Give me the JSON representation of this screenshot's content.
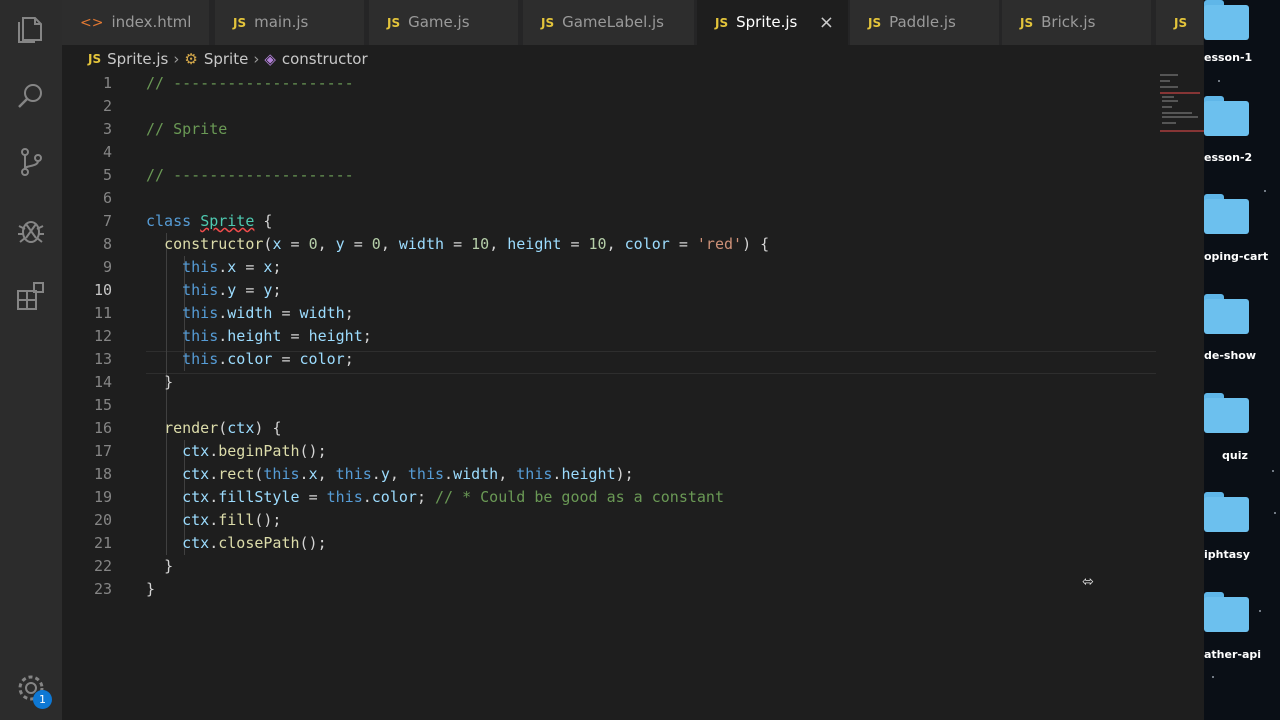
{
  "tabs": [
    {
      "label": "index.html",
      "icon": "html-icon",
      "active": false
    },
    {
      "label": "main.js",
      "icon": "js-icon",
      "active": false
    },
    {
      "label": "Game.js",
      "icon": "js-icon",
      "active": false
    },
    {
      "label": "GameLabel.js",
      "icon": "js-icon",
      "active": false
    },
    {
      "label": "Sprite.js",
      "icon": "js-icon",
      "active": true
    },
    {
      "label": "Paddle.js",
      "icon": "js-icon",
      "active": false
    },
    {
      "label": "Brick.js",
      "icon": "js-icon",
      "active": false
    }
  ],
  "tab_icon_js": "JS",
  "tab_icon_html": "<>",
  "tab_close": "×",
  "breadcrumb": {
    "file": "Sprite.js",
    "class": "Sprite",
    "member": "constructor"
  },
  "code_lines": [
    "// --------------------",
    "",
    "// Sprite",
    "",
    "// --------------------",
    "",
    "class Sprite {",
    "  constructor(x = 0, y = 0, width = 10, height = 10, color = 'red') {",
    "    this.x = x;",
    "    this.y = y;",
    "    this.width = width;",
    "    this.height = height;",
    "    this.color = color;",
    "  }",
    "",
    "  render(ctx) {",
    "    ctx.beginPath();",
    "    ctx.rect(this.x, this.y, this.width, this.height);",
    "    ctx.fillStyle = this.color; // * Could be good as a constant",
    "    ctx.fill();",
    "    ctx.closePath();",
    "  }",
    "}"
  ],
  "current_line": 10,
  "activity_bar": {
    "icons": [
      "explorer-icon",
      "search-icon",
      "source-control-icon",
      "debug-icon",
      "extensions-icon",
      "settings-gear-icon"
    ],
    "badge_count": "1"
  },
  "desktop_folders": [
    "esson-1",
    "esson-2",
    "oping-cart",
    "de-show",
    "quiz",
    "iphtasy",
    "ather-api"
  ],
  "colors": {
    "editor_bg": "#1e1e1e",
    "comment": "#6a9955",
    "keyword": "#569cd6",
    "class": "#4ec9b0",
    "function": "#dcdcaa",
    "variable": "#9cdcfe",
    "number": "#b5cea8",
    "string": "#ce9178",
    "folder": "#6cc0ee"
  }
}
